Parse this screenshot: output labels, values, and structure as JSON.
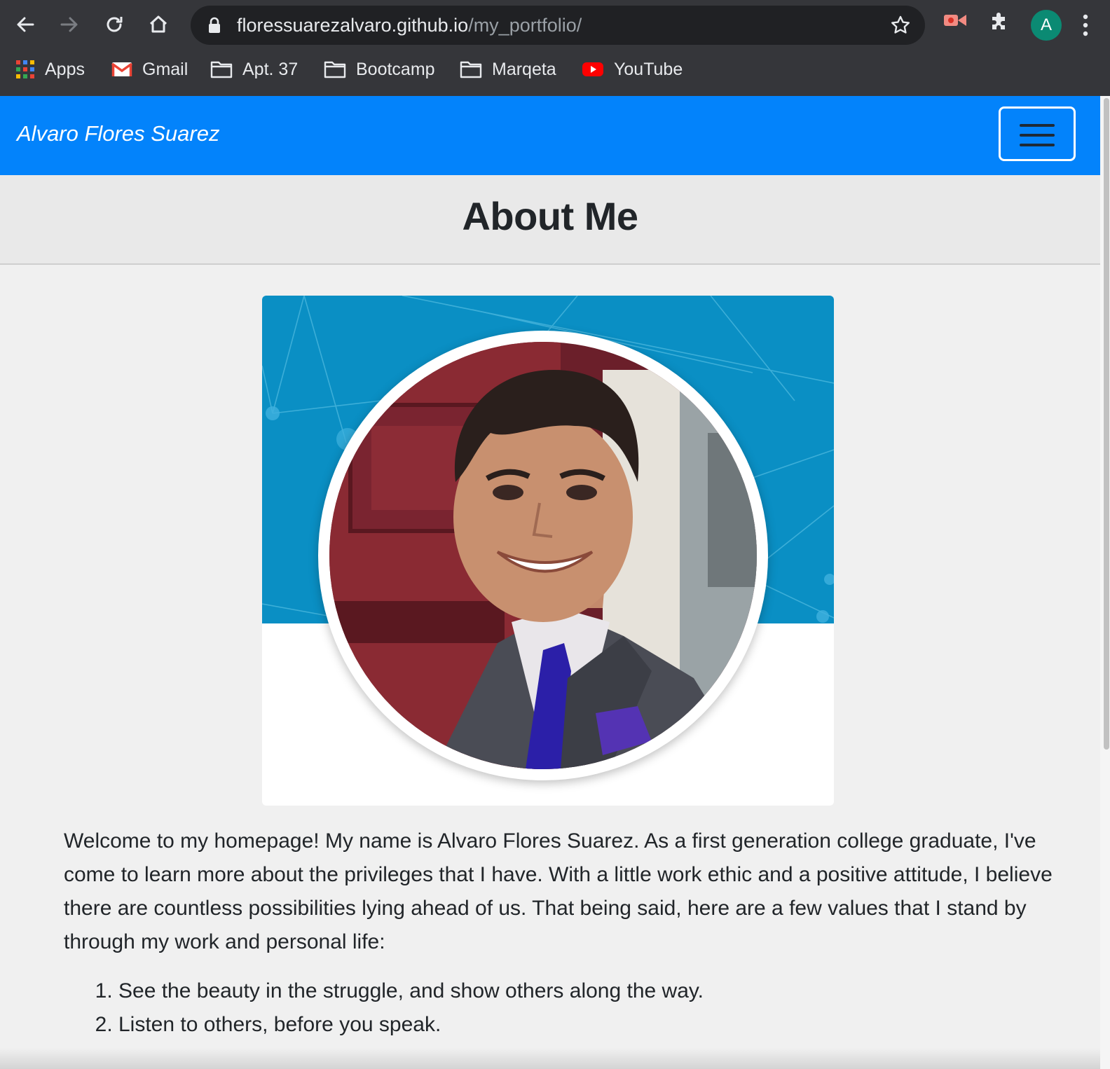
{
  "browser": {
    "url_host": "floressuarezalvaro.github.io",
    "url_path": "/my_portfolio/",
    "profile_initial": "A",
    "bookmarks": [
      {
        "label": "Apps",
        "icon": "apps-grid-icon"
      },
      {
        "label": "Gmail",
        "icon": "gmail-icon"
      },
      {
        "label": "Apt. 37",
        "icon": "folder-icon"
      },
      {
        "label": "Bootcamp",
        "icon": "folder-icon"
      },
      {
        "label": "Marqeta",
        "icon": "folder-icon"
      },
      {
        "label": "YouTube",
        "icon": "youtube-icon"
      }
    ]
  },
  "navbar": {
    "brand": "Alvaro Flores Suarez",
    "background": "#0383fb",
    "toggler_icon": "hamburger-icon"
  },
  "hero": {
    "title": "About Me"
  },
  "profile_card": {
    "banner_color": "#0a8fc4",
    "photo": "profile-photo"
  },
  "content": {
    "intro": "Welcome to my homepage! My name is Alvaro Flores Suarez. As a first generation college graduate, I've come to learn more about the privileges that I have. With a little work ethic and a positive attitude, I believe there are countless possibilities lying ahead of us. That being said, here are a few values that I stand by through my work and personal life:",
    "values": [
      "See the beauty in the struggle, and show others along the way.",
      "Listen to others, before you speak."
    ]
  }
}
